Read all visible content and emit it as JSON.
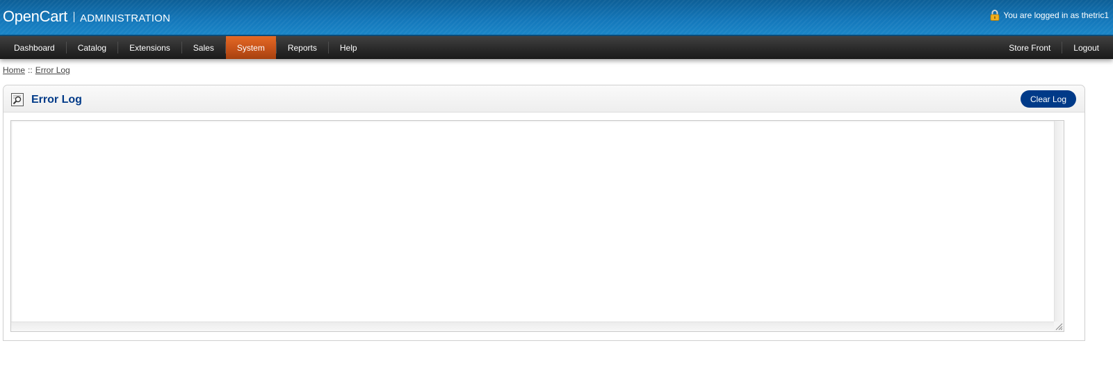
{
  "header": {
    "brand": "OpenCart",
    "subtitle": "ADMINISTRATION",
    "login_text": "You are logged in as thetric1",
    "lock_icon": "lock-icon"
  },
  "menu": {
    "left": [
      {
        "label": "Dashboard"
      },
      {
        "label": "Catalog"
      },
      {
        "label": "Extensions"
      },
      {
        "label": "Sales"
      },
      {
        "label": "System",
        "selected": true
      },
      {
        "label": "Reports"
      },
      {
        "label": "Help"
      }
    ],
    "right": [
      {
        "label": "Store Front"
      },
      {
        "label": "Logout"
      }
    ],
    "selected_color": "#c9541a"
  },
  "breadcrumb": {
    "home": "Home",
    "separator": "::",
    "current": "Error Log"
  },
  "box": {
    "title": "Error Log",
    "title_icon": "log-icon",
    "clear_button": "Clear Log",
    "log_contents": ""
  },
  "colors": {
    "header_blue": "#1272b0",
    "title_blue": "#003a88",
    "button_blue": "#003a88"
  }
}
